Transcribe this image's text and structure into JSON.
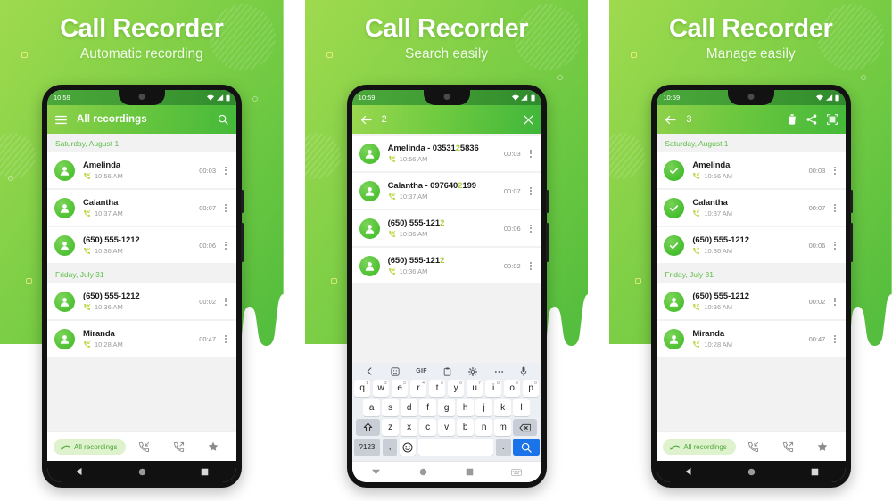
{
  "panels": [
    {
      "headline": {
        "title": "Call Recorder",
        "subtitle": "Automatic recording"
      },
      "status": {
        "time": "10:59"
      },
      "appbar": {
        "title": "All recordings",
        "menu_icon": "hamburger-icon",
        "search_icon": "search-icon"
      },
      "groups": [
        {
          "day": "Saturday, August 1",
          "rows": [
            {
              "name": "Amelinda",
              "time": "10:56 AM",
              "duration": "00:03"
            },
            {
              "name": "Calantha",
              "time": "10:37 AM",
              "duration": "00:07"
            },
            {
              "name": "(650) 555-1212",
              "time": "10:36 AM",
              "duration": "00:06"
            }
          ]
        },
        {
          "day": "Friday, July 31",
          "rows": [
            {
              "name": "(650) 555-1212",
              "time": "10:36 AM",
              "duration": "00:02"
            },
            {
              "name": "Miranda",
              "time": "10:28 AM",
              "duration": "00:47"
            }
          ]
        }
      ],
      "filterbar": {
        "pill_label": "All recordings",
        "pill_icon": "all-recordings-icon",
        "icons": [
          "incoming-call-icon",
          "outgoing-call-icon",
          "star-icon"
        ]
      }
    },
    {
      "headline": {
        "title": "Call Recorder",
        "subtitle": "Search easily"
      },
      "status": {
        "time": "10:59"
      },
      "appbar": {
        "query": "2",
        "back_icon": "back-arrow-icon",
        "close_icon": "close-icon"
      },
      "results": [
        {
          "name_pre": "Amelinda - 03531",
          "name_hl": "2",
          "name_post": "5836",
          "time": "10:56 AM",
          "duration": "00:03"
        },
        {
          "name_pre": "Calantha - 097640",
          "name_hl": "2",
          "name_post": "199",
          "time": "10:37 AM",
          "duration": "00:07"
        },
        {
          "name_pre": "(650) 555-121",
          "name_hl": "2",
          "name_post": "",
          "time": "10:36 AM",
          "duration": "00:06"
        },
        {
          "name_pre": "(650) 555-121",
          "name_hl": "2",
          "name_post": "",
          "time": "10:36 AM",
          "duration": "00:02"
        }
      ],
      "keyboard": {
        "toolbar": [
          "back-chevron-icon",
          "sticker-icon",
          "GIF",
          "clipboard-icon",
          "settings-gear-icon",
          "more-dots-icon",
          "microphone-icon"
        ],
        "row1": [
          {
            "k": "q",
            "n": "1"
          },
          {
            "k": "w",
            "n": "2"
          },
          {
            "k": "e",
            "n": "3"
          },
          {
            "k": "r",
            "n": "4"
          },
          {
            "k": "t",
            "n": "5"
          },
          {
            "k": "y",
            "n": "6"
          },
          {
            "k": "u",
            "n": "7"
          },
          {
            "k": "i",
            "n": "8"
          },
          {
            "k": "o",
            "n": "9"
          },
          {
            "k": "p",
            "n": "0"
          }
        ],
        "row2": [
          "a",
          "s",
          "d",
          "f",
          "g",
          "h",
          "j",
          "k",
          "l"
        ],
        "row3": [
          "z",
          "x",
          "c",
          "v",
          "b",
          "n",
          "m"
        ],
        "shift_icon": "shift-icon",
        "backspace_icon": "backspace-icon",
        "numeric_label": "?123",
        "comma_label": ",",
        "emoji_icon": "emoji-icon",
        "period_label": ".",
        "search_key_icon": "search-icon"
      },
      "navbar": [
        "hide-keyboard-icon",
        "home-icon",
        "recents-icon",
        "keyboard-switch-icon"
      ]
    },
    {
      "headline": {
        "title": "Call Recorder",
        "subtitle": "Manage easily"
      },
      "status": {
        "time": "10:59"
      },
      "appbar": {
        "count": "3",
        "back_icon": "back-arrow-icon",
        "actions": [
          "delete-icon",
          "share-icon",
          "select-all-icon"
        ]
      },
      "groups": [
        {
          "day": "Saturday, August 1",
          "rows": [
            {
              "name": "Amelinda",
              "time": "10:56 AM",
              "duration": "00:03",
              "selected": true
            },
            {
              "name": "Calantha",
              "time": "10:37 AM",
              "duration": "00:07",
              "selected": true
            },
            {
              "name": "(650) 555-1212",
              "time": "10:36 AM",
              "duration": "00:06",
              "selected": true
            }
          ]
        },
        {
          "day": "Friday, July 31",
          "rows": [
            {
              "name": "(650) 555-1212",
              "time": "10:36 AM",
              "duration": "00:02",
              "selected": false
            },
            {
              "name": "Miranda",
              "time": "10:28 AM",
              "duration": "00:47",
              "selected": false
            }
          ]
        }
      ],
      "filterbar": {
        "pill_label": "All recordings",
        "pill_icon": "all-recordings-icon",
        "icons": [
          "incoming-call-icon",
          "outgoing-call-icon",
          "star-icon"
        ]
      }
    }
  ],
  "colors": {
    "brand_green": "#6dc83f",
    "dark_green": "#45b93a",
    "light_green": "#9ad84f",
    "highlight_yellow": "#a6cf3c",
    "avatar_green": "#4fc133",
    "pill_bg": "#ddf2cd",
    "pill_text": "#52a83c"
  }
}
